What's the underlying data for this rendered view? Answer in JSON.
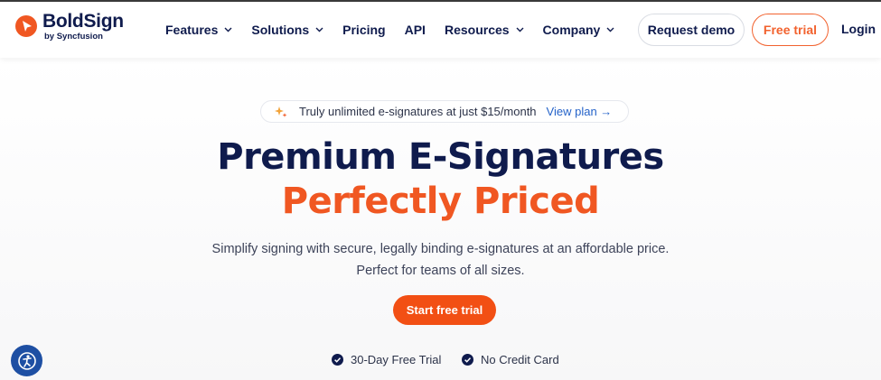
{
  "brand": {
    "name": "BoldSign",
    "sub": "by Syncfusion",
    "accent_color": "#f05722",
    "navy_color": "#0f1b4d"
  },
  "nav": {
    "items": [
      {
        "label": "Features",
        "dropdown": true
      },
      {
        "label": "Solutions",
        "dropdown": true
      },
      {
        "label": "Pricing",
        "dropdown": false
      },
      {
        "label": "API",
        "dropdown": false
      },
      {
        "label": "Resources",
        "dropdown": true
      },
      {
        "label": "Company",
        "dropdown": true
      }
    ],
    "request_demo": "Request demo",
    "free_trial": "Free trial",
    "login": "Login"
  },
  "promo": {
    "text": "Truly unlimited e-signatures at just $15/month",
    "link": "View plan →",
    "icon": "sparkle-icon"
  },
  "hero": {
    "title_line1": "Premium E-Signatures",
    "title_line2": "Perfectly Priced",
    "subtitle_line1": "Simplify signing with secure, legally binding e-signatures at an affordable price.",
    "subtitle_line2": "Perfect for teams of all sizes.",
    "cta": "Start free trial"
  },
  "features": [
    "30-Day Free Trial",
    "No Credit Card"
  ],
  "accessibility": {
    "icon": "accessibility-icon"
  }
}
